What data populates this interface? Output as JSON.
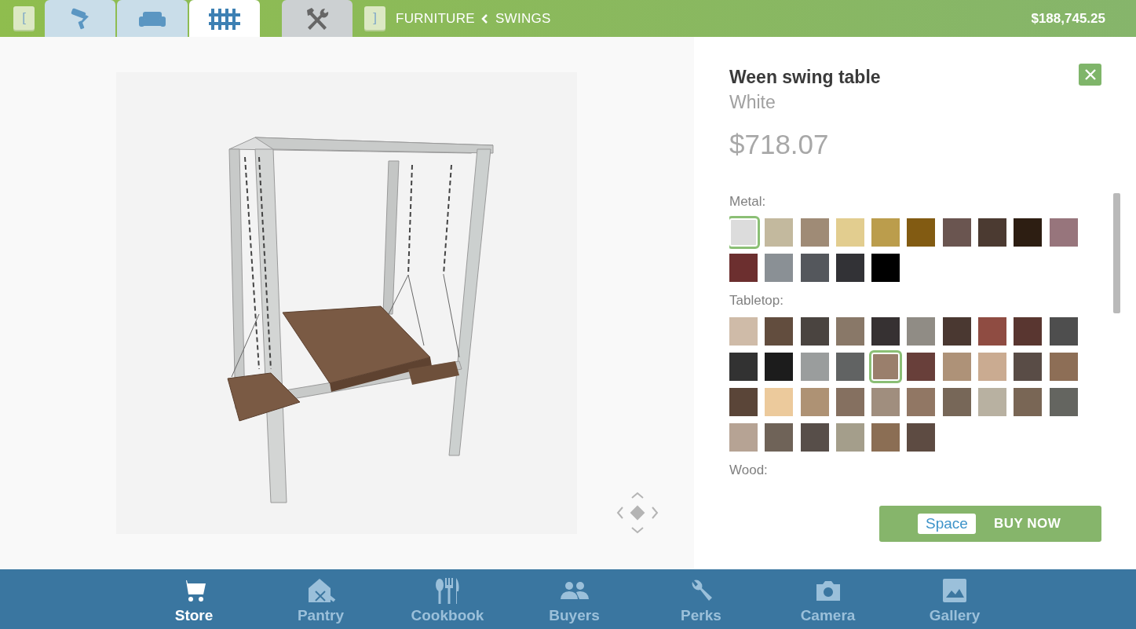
{
  "top_bar": {
    "left_key": "[",
    "right_key": "]",
    "tabs": [
      {
        "kind": "paint",
        "selected": false
      },
      {
        "kind": "sofa",
        "selected": false
      },
      {
        "kind": "fence",
        "selected": true
      },
      {
        "kind": "tools",
        "selected": false
      }
    ],
    "breadcrumb": [
      "FURNITURE",
      "SWINGS"
    ],
    "balance": "$188,745.25"
  },
  "item": {
    "name": "Ween swing table",
    "variant": "White",
    "price": "$718.07"
  },
  "sections": [
    {
      "label": "Metal:",
      "swatches": [
        {
          "color": "#dcdcdc",
          "selected": true
        },
        {
          "color": "#c3b99e",
          "selected": false
        },
        {
          "color": "#9f8b76",
          "selected": false
        },
        {
          "color": "#e2cd8f",
          "selected": false
        },
        {
          "color": "#bb9d4c",
          "selected": false
        },
        {
          "color": "#825b12",
          "selected": false
        },
        {
          "color": "#6a5550",
          "selected": false
        },
        {
          "color": "#4b3a31",
          "selected": false
        },
        {
          "color": "#2d1e12",
          "selected": false
        },
        {
          "color": "#97757c",
          "selected": false
        },
        {
          "color": "#6c2f2f",
          "selected": false
        },
        {
          "color": "#8a9095",
          "selected": false
        },
        {
          "color": "#54575c",
          "selected": false
        },
        {
          "color": "#323236",
          "selected": false
        },
        {
          "color": "#000000",
          "selected": false
        }
      ]
    },
    {
      "label": "Tabletop:",
      "swatches": [
        {
          "color": "#cfbba8",
          "selected": false
        },
        {
          "color": "#624d3e",
          "selected": false
        },
        {
          "color": "#4a4440",
          "selected": false
        },
        {
          "color": "#897868",
          "selected": false
        },
        {
          "color": "#363132",
          "selected": false
        },
        {
          "color": "#908c85",
          "selected": false
        },
        {
          "color": "#4a3831",
          "selected": false
        },
        {
          "color": "#8f4c42",
          "selected": false
        },
        {
          "color": "#593630",
          "selected": false
        },
        {
          "color": "#4e4e4e",
          "selected": false
        },
        {
          "color": "#323232",
          "selected": false
        },
        {
          "color": "#1c1c1c",
          "selected": false
        },
        {
          "color": "#9a9d9d",
          "selected": false
        },
        {
          "color": "#616363",
          "selected": false
        },
        {
          "color": "#9a7f6c",
          "selected": true
        },
        {
          "color": "#683f3a",
          "selected": false
        },
        {
          "color": "#ae9278",
          "selected": false
        },
        {
          "color": "#caab91",
          "selected": false
        },
        {
          "color": "#594c46",
          "selected": false
        },
        {
          "color": "#8d6e56",
          "selected": false
        },
        {
          "color": "#5a4538",
          "selected": false
        },
        {
          "color": "#ecca9c",
          "selected": false
        },
        {
          "color": "#ae9274",
          "selected": false
        },
        {
          "color": "#857060",
          "selected": false
        },
        {
          "color": "#a08e7e",
          "selected": false
        },
        {
          "color": "#917764",
          "selected": false
        },
        {
          "color": "#776758",
          "selected": false
        },
        {
          "color": "#b8b1a1",
          "selected": false
        },
        {
          "color": "#796655",
          "selected": false
        },
        {
          "color": "#646560",
          "selected": false
        },
        {
          "color": "#b6a394",
          "selected": false
        },
        {
          "color": "#6f6358",
          "selected": false
        },
        {
          "color": "#574e49",
          "selected": false
        },
        {
          "color": "#a49e8b",
          "selected": false
        },
        {
          "color": "#8b6e54",
          "selected": false
        },
        {
          "color": "#5d4b42",
          "selected": false
        }
      ]
    },
    {
      "label": "Wood:"
    }
  ],
  "buy_button": {
    "key_hint": "Space",
    "label": "BUY NOW"
  },
  "bottom_nav": [
    {
      "kind": "store",
      "label": "Store",
      "selected": true
    },
    {
      "kind": "pantry",
      "label": "Pantry",
      "selected": false
    },
    {
      "kind": "cookbook",
      "label": "Cookbook",
      "selected": false
    },
    {
      "kind": "buyers",
      "label": "Buyers",
      "selected": false
    },
    {
      "kind": "perks",
      "label": "Perks",
      "selected": false
    },
    {
      "kind": "camera",
      "label": "Camera",
      "selected": false
    },
    {
      "kind": "gallery",
      "label": "Gallery",
      "selected": false
    }
  ]
}
